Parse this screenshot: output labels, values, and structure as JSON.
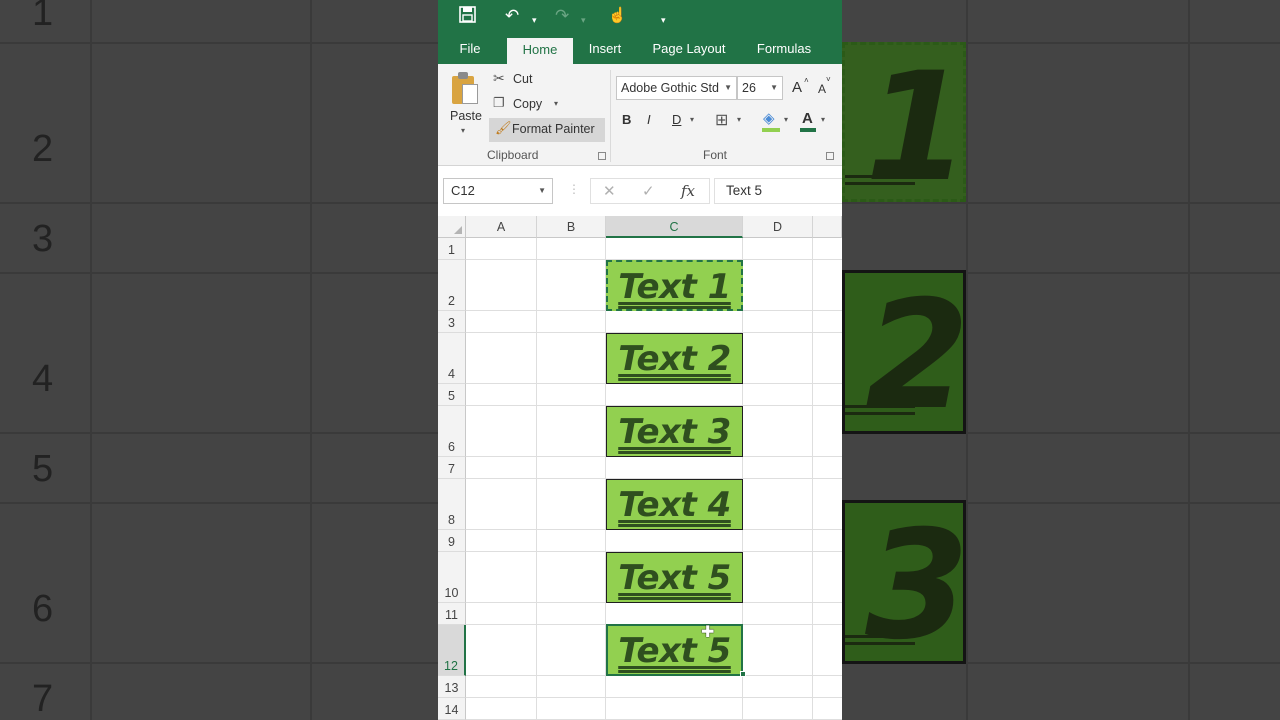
{
  "background": {
    "left_row_numbers": [
      "1",
      "2",
      "3",
      "4",
      "5",
      "6",
      "7"
    ],
    "right_numbers": [
      "1",
      "2",
      "3"
    ]
  },
  "qat": {
    "save_icon": "save-icon",
    "undo_icon": "undo-icon",
    "redo_icon": "redo-icon",
    "touch_icon": "touch-mode-icon",
    "customize_icon": "customize-qat-icon"
  },
  "tabs": [
    "File",
    "Home",
    "Insert",
    "Page Layout",
    "Formulas"
  ],
  "active_tab": "Home",
  "clipboard": {
    "paste_label": "Paste",
    "cut_label": "Cut",
    "copy_label": "Copy",
    "format_painter_label": "Format Painter",
    "group_label": "Clipboard"
  },
  "font": {
    "font_name": "Adobe Gothic Std",
    "font_size": "26",
    "grow_label": "A",
    "shrink_label": "A",
    "bold_label": "B",
    "italic_label": "I",
    "underline_label": "D",
    "font_color_label": "A",
    "group_label": "Font"
  },
  "formula_bar": {
    "name_box": "C12",
    "cancel": "✕",
    "enter": "✓",
    "fx": "fx",
    "value": "Text 5"
  },
  "grid": {
    "columns": [
      "A",
      "B",
      "C",
      "D"
    ],
    "selected_column": "C",
    "rows": [
      "1",
      "2",
      "3",
      "4",
      "5",
      "6",
      "7",
      "8",
      "9",
      "10",
      "11",
      "12",
      "13",
      "14"
    ],
    "selected_row": "12",
    "cells": [
      {
        "ref": "C2",
        "text": "Text 1"
      },
      {
        "ref": "C4",
        "text": "Text 2"
      },
      {
        "ref": "C6",
        "text": "Text 3"
      },
      {
        "ref": "C8",
        "text": "Text 4"
      },
      {
        "ref": "C10",
        "text": "Text 5"
      },
      {
        "ref": "C12",
        "text": "Text 5"
      }
    ]
  },
  "colors": {
    "excel_green": "#217346",
    "cell_fill": "#92d050",
    "cell_text": "#2f4f1f"
  }
}
